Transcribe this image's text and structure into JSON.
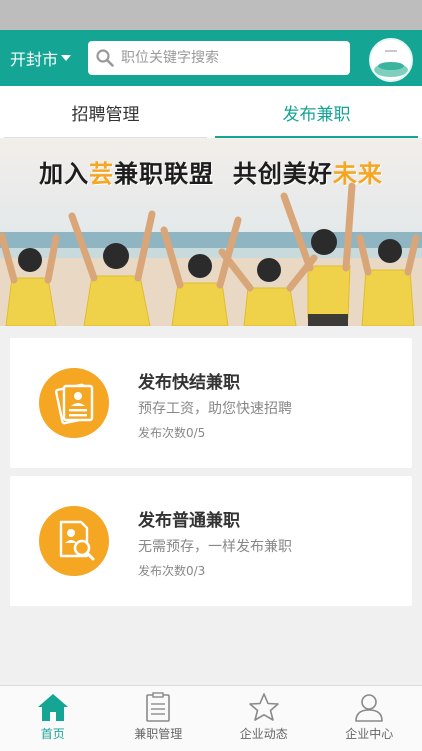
{
  "header": {
    "city": "开封市",
    "search_placeholder": "职位关键字搜索"
  },
  "tabs": [
    {
      "label": "招聘管理",
      "active": false
    },
    {
      "label": "发布兼职",
      "active": true
    }
  ],
  "banner": {
    "part1": "加入",
    "highlight1": "芸",
    "part2": "兼职联盟",
    "part3": "共创美好",
    "highlight2": "未来"
  },
  "cards": [
    {
      "title": "发布快结兼职",
      "subtitle": "预存工资，助您快速招聘",
      "count": "发布次数0/5"
    },
    {
      "title": "发布普通兼职",
      "subtitle": "无需预存，一样发布兼职",
      "count": "发布次数0/3"
    }
  ],
  "bottom_nav": [
    {
      "label": "首页",
      "icon": "home-icon",
      "active": true
    },
    {
      "label": "兼职管理",
      "icon": "clipboard-icon",
      "active": false
    },
    {
      "label": "企业动态",
      "icon": "star-icon",
      "active": false
    },
    {
      "label": "企业中心",
      "icon": "user-icon",
      "active": false
    }
  ],
  "colors": {
    "primary": "#14a595",
    "accent": "#f5a623"
  }
}
